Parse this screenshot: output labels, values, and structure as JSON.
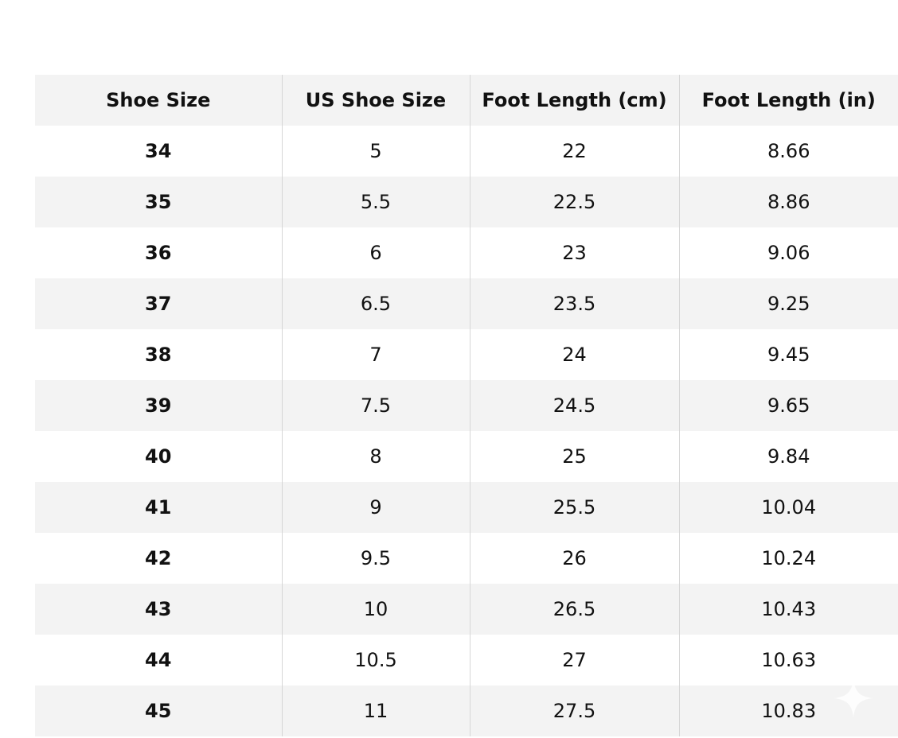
{
  "table": {
    "headers": [
      "Shoe Size",
      "US Shoe Size",
      "Foot Length (cm)",
      "Foot Length (in)"
    ],
    "rows": [
      [
        "34",
        "5",
        "22",
        "8.66"
      ],
      [
        "35",
        "5.5",
        "22.5",
        "8.86"
      ],
      [
        "36",
        "6",
        "23",
        "9.06"
      ],
      [
        "37",
        "6.5",
        "23.5",
        "9.25"
      ],
      [
        "38",
        "7",
        "24",
        "9.45"
      ],
      [
        "39",
        "7.5",
        "24.5",
        "9.65"
      ],
      [
        "40",
        "8",
        "25",
        "9.84"
      ],
      [
        "41",
        "9",
        "25.5",
        "10.04"
      ],
      [
        "42",
        "9.5",
        "26",
        "10.24"
      ],
      [
        "43",
        "10",
        "26.5",
        "10.43"
      ],
      [
        "44",
        "10.5",
        "27",
        "10.63"
      ],
      [
        "45",
        "11",
        "27.5",
        "10.83"
      ]
    ]
  },
  "colors": {
    "stripe": "#f3f3f3",
    "divider": "#d6d6d6",
    "text": "#111111"
  },
  "icons": {
    "corner": "sparkle-icon"
  }
}
